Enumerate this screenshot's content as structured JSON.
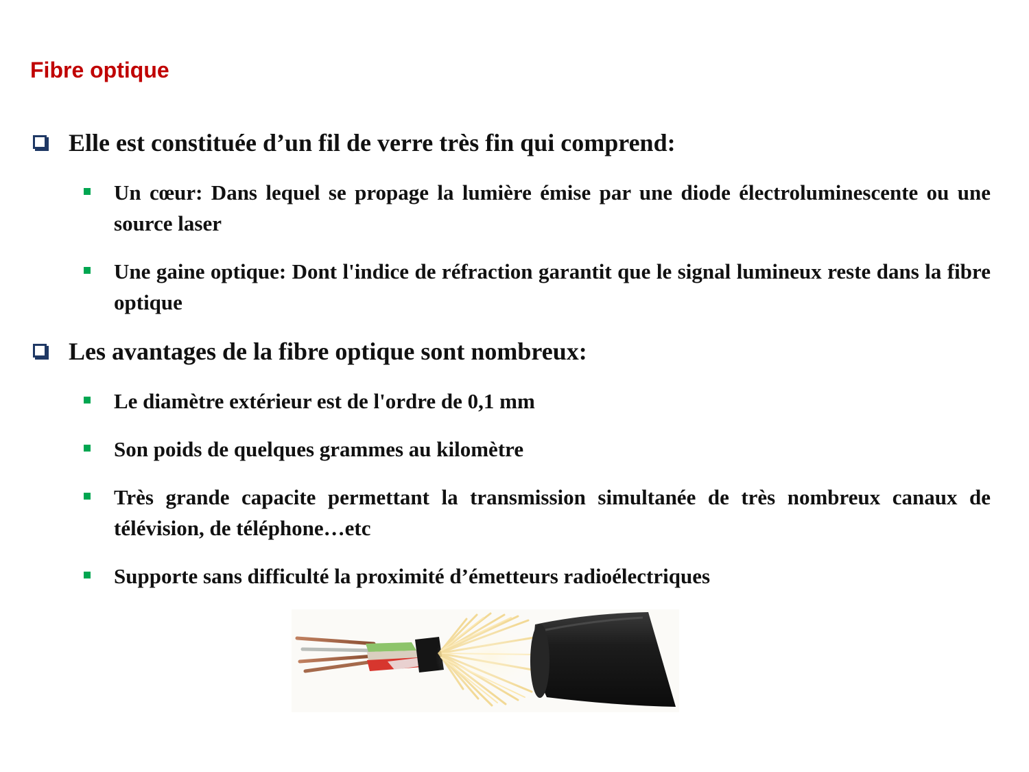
{
  "slide": {
    "title": "Fibre optique",
    "sections": [
      {
        "heading": "Elle est constituée d’un fil de verre très fin qui comprend:",
        "items": [
          "Un cœur: Dans lequel se propage la lumière émise par une diode électroluminescente ou une source laser",
          "Une gaine optique: Dont l'indice de réfraction garantit que le signal lumineux reste dans la fibre optique"
        ]
      },
      {
        "heading": "Les avantages de la fibre optique sont nombreux:",
        "items": [
          "Le diamètre extérieur est de l'ordre de 0,1 mm",
          "Son poids de quelques grammes au kilomètre",
          "Très grande capacite permettant la transmission simultanée de très nombreux canaux de télévision, de téléphone…etc",
          "Supporte sans difficulté la proximité d’émetteurs radioélectriques"
        ]
      }
    ]
  },
  "colors": {
    "title": "#c00000",
    "checkbox_bullet": "#1f3864",
    "square_bullet": "#00a651",
    "text": "#111111"
  },
  "icons": {
    "level1_bullet": "checkbox-square-icon",
    "level2_bullet": "green-square-bullet-icon",
    "picture": "fiber-optic-cable-photo"
  }
}
